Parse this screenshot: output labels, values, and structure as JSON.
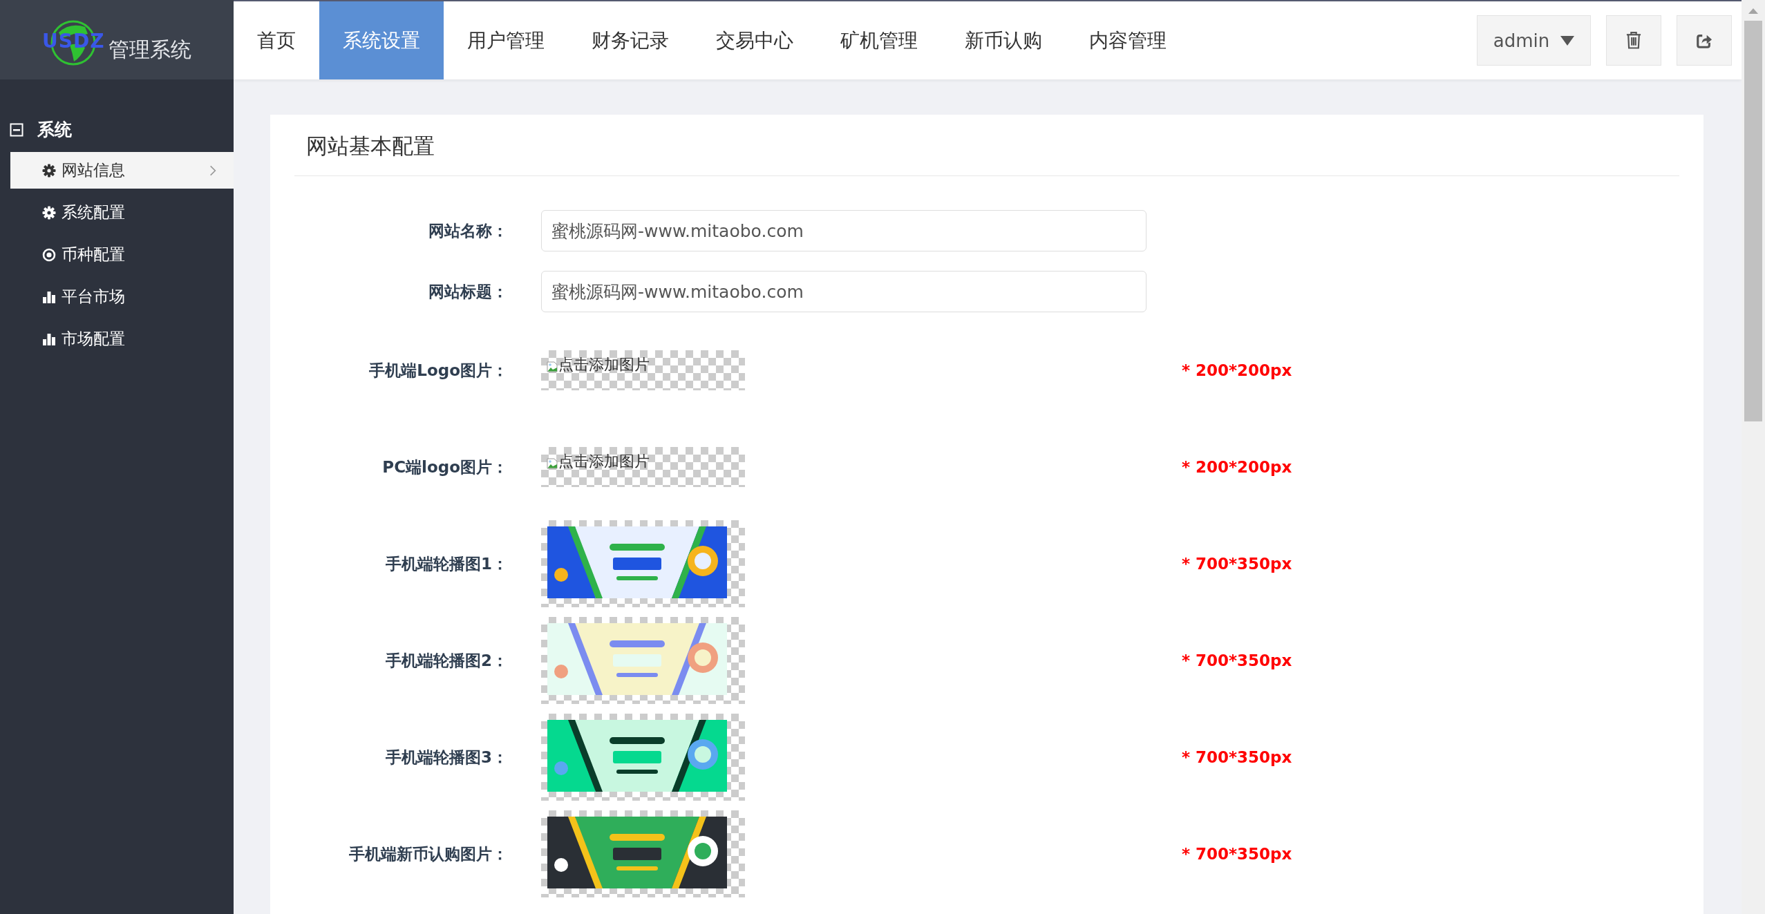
{
  "logo": {
    "mark": "USDZ",
    "title": "管理系统"
  },
  "nav": [
    {
      "label": "首页",
      "selected": false
    },
    {
      "label": "系统设置",
      "selected": true
    },
    {
      "label": "用户管理",
      "selected": false
    },
    {
      "label": "财务记录",
      "selected": false
    },
    {
      "label": "交易中心",
      "selected": false
    },
    {
      "label": "矿机管理",
      "selected": false
    },
    {
      "label": "新币认购",
      "selected": false
    },
    {
      "label": "内容管理",
      "selected": false
    }
  ],
  "user_menu": {
    "label": "admin"
  },
  "sidebar": {
    "group": {
      "label": "系统",
      "expanded": true
    },
    "items": [
      {
        "label": "网站信息",
        "kind": "gear",
        "selected": true
      },
      {
        "label": "系统配置",
        "kind": "gear",
        "selected": false
      },
      {
        "label": "币种配置",
        "kind": "radio",
        "selected": false
      },
      {
        "label": "平台市场",
        "kind": "chart",
        "selected": false
      },
      {
        "label": "市场配置",
        "kind": "chart",
        "selected": false
      }
    ]
  },
  "card": {
    "title": "网站基本配置",
    "fields": [
      {
        "label": "网站名称：",
        "value": "蜜桃源码网-www.mitaobo.com"
      },
      {
        "label": "网站标题：",
        "value": "蜜桃源码网-www.mitaobo.com"
      }
    ],
    "images": [
      {
        "label": "手机端Logo图片：",
        "kind": "broken",
        "alt": "点击添加图片",
        "note": "* 200*200px"
      },
      {
        "label": "PC端logo图片：",
        "kind": "broken",
        "alt": "点击添加图片",
        "note": "* 200*200px"
      },
      {
        "label": "手机端轮播图1：",
        "kind": "picture",
        "note": "* 700*350px"
      },
      {
        "label": "手机端轮播图2：",
        "kind": "picture",
        "note": "* 700*350px"
      },
      {
        "label": "手机端轮播图3：",
        "kind": "picture",
        "note": "* 700*350px"
      },
      {
        "label": "手机端新币认购图片：",
        "kind": "picture",
        "note": "* 700*350px"
      }
    ]
  }
}
